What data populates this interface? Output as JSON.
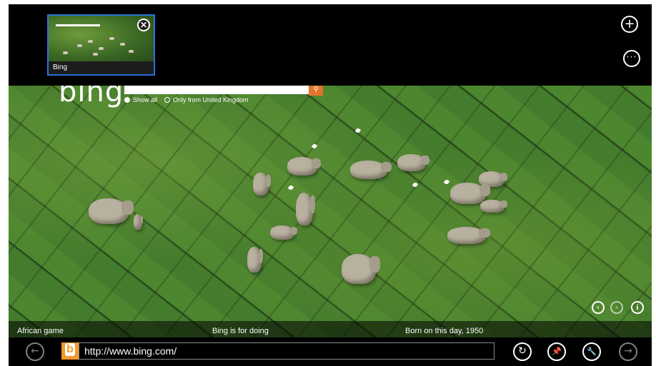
{
  "tabs": [
    {
      "title": "Bing",
      "active": true
    }
  ],
  "tab_controls": {
    "close_glyph": "✕",
    "new_tab_glyph": "+",
    "more_glyph": "···"
  },
  "bing_page": {
    "logo_text": "bing",
    "search_glyph": "⚲",
    "filters": {
      "show_all": "Show all",
      "only_uk": "Only from United Kingdom"
    },
    "captions": [
      "African game",
      "Bing is for doing",
      "Born on this day, 1950"
    ],
    "nav": {
      "prev_glyph": "‹",
      "next_glyph": "›",
      "info_glyph": "i"
    }
  },
  "app_bar": {
    "back_glyph": "←",
    "forward_glyph": "→",
    "url": "http://www.bing.com/",
    "refresh_glyph": "↻",
    "pin_glyph": "📌",
    "tools_glyph": "🔧"
  },
  "colors": {
    "accent": "#2a73d8",
    "bing_orange": "#e2742a",
    "grass": "#447c2d"
  }
}
